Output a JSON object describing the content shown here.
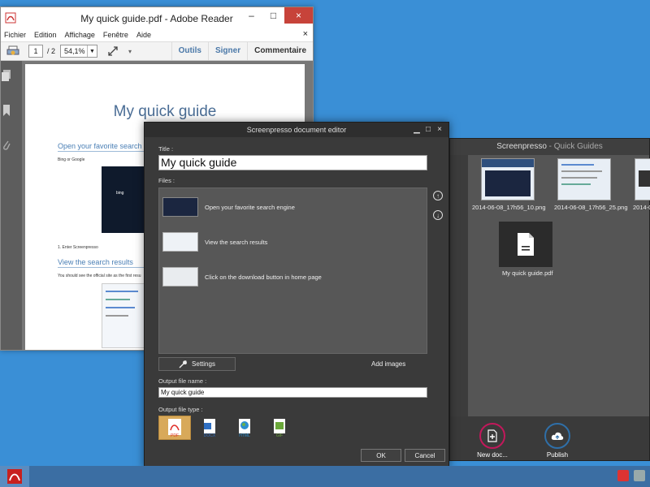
{
  "reader": {
    "title": "My quick guide.pdf - Adobe Reader",
    "menu": [
      "Fichier",
      "Edition",
      "Affichage",
      "Fenêtre",
      "Aide"
    ],
    "close_doc": "×",
    "page_current": "1",
    "page_total": "/ 2",
    "zoom": "54,1%",
    "tools": [
      "Outils",
      "Signer",
      "Commentaire"
    ],
    "doc": {
      "title": "My quick guide",
      "section1": "Open your favorite search",
      "caption1": "Bing or Google",
      "step1": "1. Enter Screenpresso",
      "section2": "View the search results",
      "caption2": "You should see the official site as the first resu"
    },
    "win_min": "–",
    "win_max": "□",
    "win_close": "×"
  },
  "main_window": {
    "title": "Screenpresso",
    "title_sep": " - ",
    "subtitle": "Quick Guides",
    "thumbnails": [
      {
        "label": "2014-06-08_17h56_10.png"
      },
      {
        "label": "2014-06-08_17h56_25.png"
      },
      {
        "label": "2014-0"
      }
    ],
    "pdf_label": "My quick guide.pdf",
    "actions": {
      "new_doc": "New doc...",
      "publish": "Publish"
    }
  },
  "editor": {
    "title": "Screenpresso document editor",
    "title_label": "Title :",
    "title_value": "My quick guide",
    "files_label": "Files :",
    "files": [
      {
        "name": "Open your favorite search engine"
      },
      {
        "name": "View the search results"
      },
      {
        "name": "Click on the download button in home page"
      }
    ],
    "settings": "Settings",
    "add_images": "Add images",
    "output_name_label": "Output file name :",
    "output_name": "My quick guide",
    "output_type_label": "Output file type :",
    "types": [
      {
        "label": "PDF",
        "color": "#e0302a",
        "selected": true
      },
      {
        "label": "DOCX",
        "color": "#2f6fc2",
        "selected": false
      },
      {
        "label": "HTML",
        "color": "#2c8fd0",
        "selected": false
      },
      {
        "label": "GIF",
        "color": "#6aa83a",
        "selected": false
      }
    ],
    "ok": "OK",
    "cancel": "Cancel"
  },
  "colors": {
    "desktop": "#3a8fd6",
    "accent_new_doc": "#c2185b",
    "accent_publish": "#2f6fa8"
  }
}
